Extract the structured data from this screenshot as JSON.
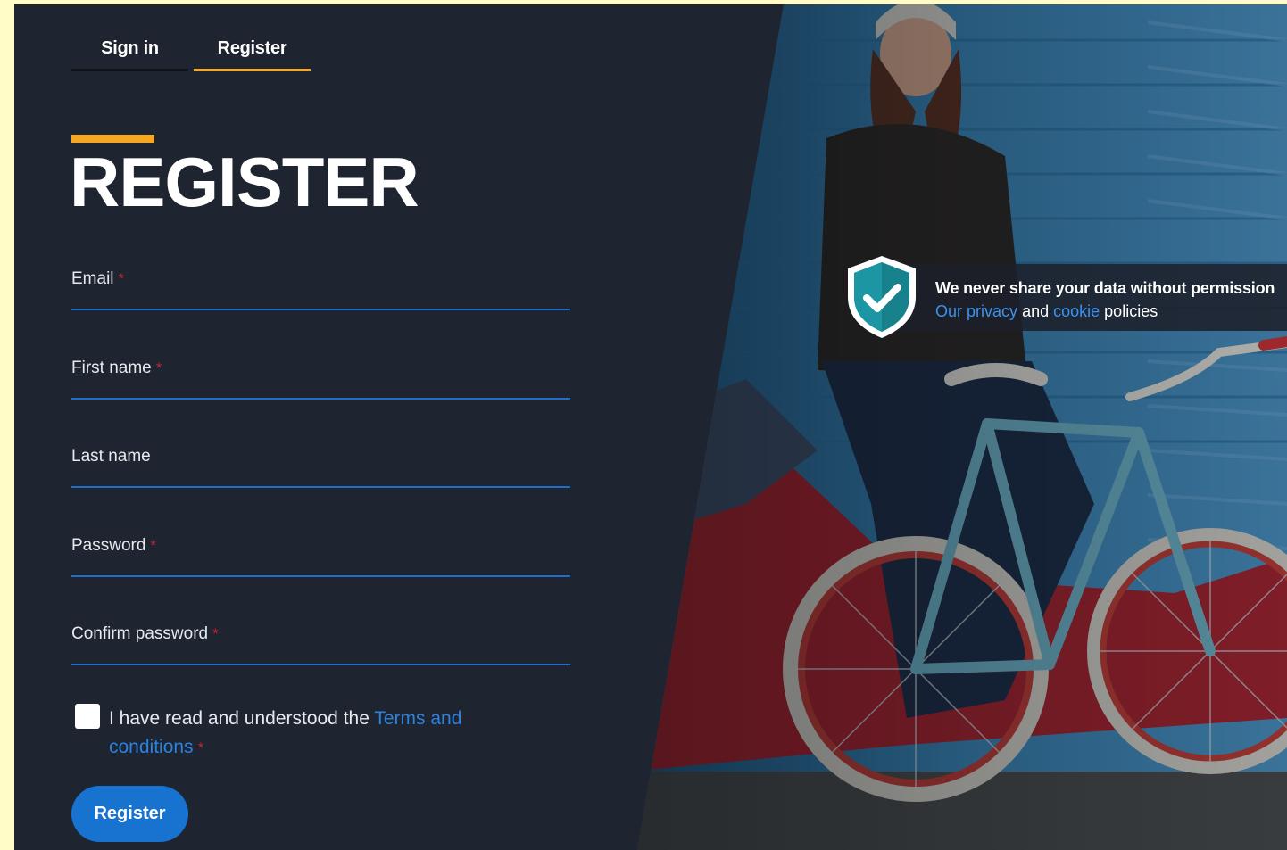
{
  "tabs": [
    {
      "label": "Sign in",
      "active": false
    },
    {
      "label": "Register",
      "active": true
    }
  ],
  "page": {
    "title": "REGISTER"
  },
  "form": {
    "fields": [
      {
        "label": "Email",
        "required_mark": "*",
        "value": ""
      },
      {
        "label": "First name",
        "required_mark": "*",
        "value": ""
      },
      {
        "label": "Last name",
        "required_mark": "",
        "value": ""
      },
      {
        "label": "Password",
        "required_mark": "*",
        "value": ""
      },
      {
        "label": "Confirm password",
        "required_mark": "*",
        "value": ""
      }
    ],
    "terms": {
      "checked": false,
      "text_before": "I have read and understood the",
      "link_text": "Terms and conditions",
      "required_mark": "*"
    },
    "submit_label": "Register"
  },
  "privacy_notice": {
    "title": "We never share your data without permission",
    "prefix": "Our",
    "privacy_link": "privacy",
    "and": "and",
    "cookie_link": "cookie",
    "suffix": "policies",
    "icon": "shield-check-icon"
  },
  "colors": {
    "background": "#1e2430",
    "accent": "#f5a623",
    "link": "#2b83e0",
    "button": "#1772d0",
    "required": "#c0253a",
    "shield": "#17818c"
  }
}
